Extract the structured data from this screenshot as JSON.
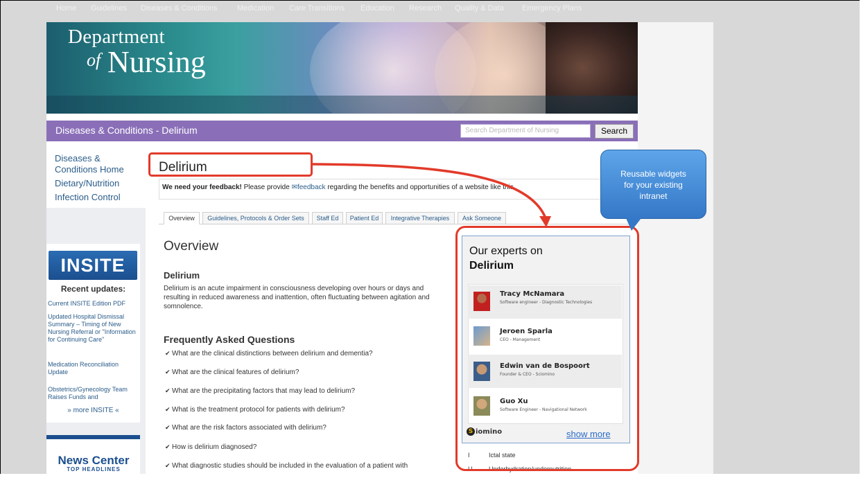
{
  "header": {
    "logo_line1": "Department",
    "logo_of": "of",
    "logo_line2": "Nursing",
    "nav": [
      "Home",
      "Guidelines",
      "Diseases & Conditions",
      "Medication",
      "Care Transitions",
      "Education",
      "Research",
      "Quality & Data",
      "Emergency Plans"
    ]
  },
  "section": {
    "title": "Diseases & Conditions - Delirium",
    "search_placeholder": "Search Department of Nursing",
    "search_button": "Search"
  },
  "left_nav": {
    "links": [
      "Diseases & Conditions Home",
      "Dietary/Nutrition",
      "Infection Control"
    ],
    "insite_logo": "INSITE",
    "recent_updates": "Recent updates:",
    "insite_links": [
      "Current INSITE Edition PDF",
      "Updated Hospital Dismissal Summary – Timing of New Nursing Referral or \"Information for Continuing Care\"",
      "Medication Reconciliation Update",
      "Obstetrics/Gynecology Team Raises Funds and"
    ],
    "more_insite": "» more INSITE «",
    "news_title": "News Center",
    "news_sub": "TOP HEADLINES"
  },
  "main": {
    "title": "Delirium",
    "feedback_bold": "We need your feedback!",
    "feedback_pre": " Please provide ",
    "feedback_link": "feedback",
    "feedback_post": " regarding the benefits and opportunities of a website like this.",
    "tabs": [
      "Overview",
      "Guidelines, Protocols & Order Sets",
      "Staff Ed",
      "Patient Ed",
      "Integrative Therapies",
      "Ask Someone"
    ],
    "overview_heading": "Overview",
    "delirium_heading": "Delirium",
    "delirium_text": "Delirium is an acute impairment in consciousness developing over hours or days and resulting in reduced awareness and inattention, often fluctuating between agitation and somnolence.",
    "faq_heading": "Frequently Asked Questions",
    "faq": [
      "What are the clinical distinctions between delirium and dementia?",
      "What are the clinical features of delirium?",
      "What are the precipitating factors that may lead to delirium?",
      "What is the treatment protocol for patients with delirium?",
      "What are the risk factors associated with delirium?",
      "How is delirium diagnosed?",
      "What diagnostic studies should be included in the evaluation of a patient with"
    ]
  },
  "widget": {
    "heading_line1": "Our experts on",
    "heading_line2": "Delirium",
    "experts": [
      {
        "name": "Tracy McNamara",
        "role": "Software engineer - Diagnostic Technologies"
      },
      {
        "name": "Jeroen Sparla",
        "role": "CEO - Management"
      },
      {
        "name": "Edwin van de Bospoort",
        "role": "Founder & CEO - Sciomino"
      },
      {
        "name": "Guo Xu",
        "role": "Software Engineer - Navigational Network"
      }
    ],
    "logo_mark": "S",
    "logo_text": "iomino",
    "show_more": "show more",
    "below_rows": [
      {
        "num": "I",
        "text": "Ictal state"
      },
      {
        "num": "U",
        "text": "Underhydration/undernutrition"
      }
    ]
  },
  "tooltip": {
    "text_line1": "Reusable widgets",
    "text_line2": "for your existing",
    "text_line3": "intranet"
  },
  "colors": {
    "section_bar": "#8a6fb8",
    "highlight": "#e23a2a",
    "tooltip": "#3578c7",
    "link": "#2a5c8a"
  }
}
